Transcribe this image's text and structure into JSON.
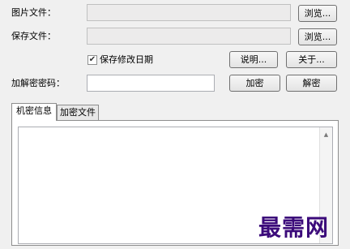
{
  "image_file": {
    "label": "图片文件：",
    "browse_label": "浏览..."
  },
  "save_file": {
    "label": "保存文件：",
    "browse_label": "浏览..."
  },
  "keep_date": {
    "label": "保存修改日期",
    "checked": true
  },
  "buttons": {
    "about_help": "说明...",
    "about": "关于...",
    "encrypt": "加密",
    "decrypt": "解密"
  },
  "password": {
    "label": "加解密密码：",
    "value": ""
  },
  "tabs": [
    {
      "label": "机密信息",
      "active": true
    },
    {
      "label": "加密文件",
      "active": false
    }
  ],
  "watermark": "最需网"
}
